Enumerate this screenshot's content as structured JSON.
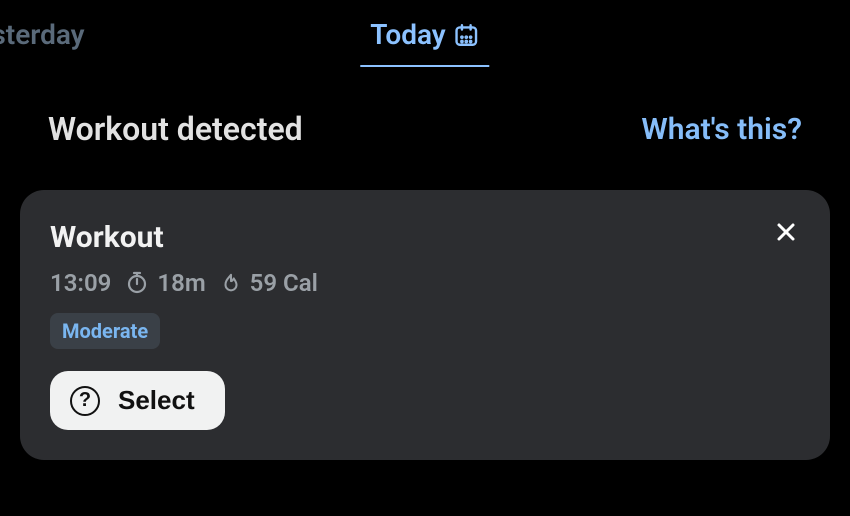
{
  "tabs": {
    "previous": "Yesterday",
    "active": "Today"
  },
  "header": {
    "title": "Workout detected",
    "link": "What's this?"
  },
  "card": {
    "title": "Workout",
    "time": "13:09",
    "duration": "18m",
    "calories": "59 Cal",
    "intensity": "Moderate",
    "select_label": "Select"
  }
}
